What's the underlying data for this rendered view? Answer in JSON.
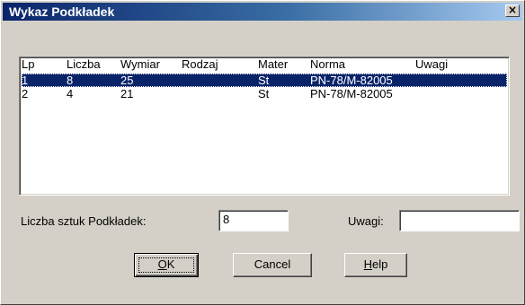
{
  "window": {
    "title": "Wykaz Podkładek",
    "close_glyph": "×"
  },
  "list": {
    "columns": [
      "Lp",
      "Liczba",
      "Wymiar",
      "Rodzaj",
      "Mater",
      "Norma",
      "Uwagi"
    ],
    "rows": [
      {
        "lp": "1",
        "liczba": "8",
        "wymiar": "25",
        "rodzaj": "",
        "mater": "St",
        "norma": "PN-78/M-82005",
        "uwagi": "",
        "selected": true
      },
      {
        "lp": "2",
        "liczba": "4",
        "wymiar": "21",
        "rodzaj": "",
        "mater": "St",
        "norma": "PN-78/M-82005",
        "uwagi": "",
        "selected": false
      }
    ]
  },
  "form": {
    "count_label": "Liczba sztuk Podkładek:",
    "count_value": "8",
    "notes_label": "Uwagi:",
    "notes_value": ""
  },
  "buttons": {
    "ok": {
      "label": "OK",
      "mnemonic": "O",
      "rest": "K"
    },
    "cancel": {
      "label": "Cancel"
    },
    "help": {
      "label": "Help",
      "mnemonic": "H",
      "rest": "elp"
    }
  },
  "colors": {
    "title_start": "#0a246a",
    "title_end": "#a6caf0",
    "selection": "#0a246a",
    "face": "#d4d0c8"
  }
}
